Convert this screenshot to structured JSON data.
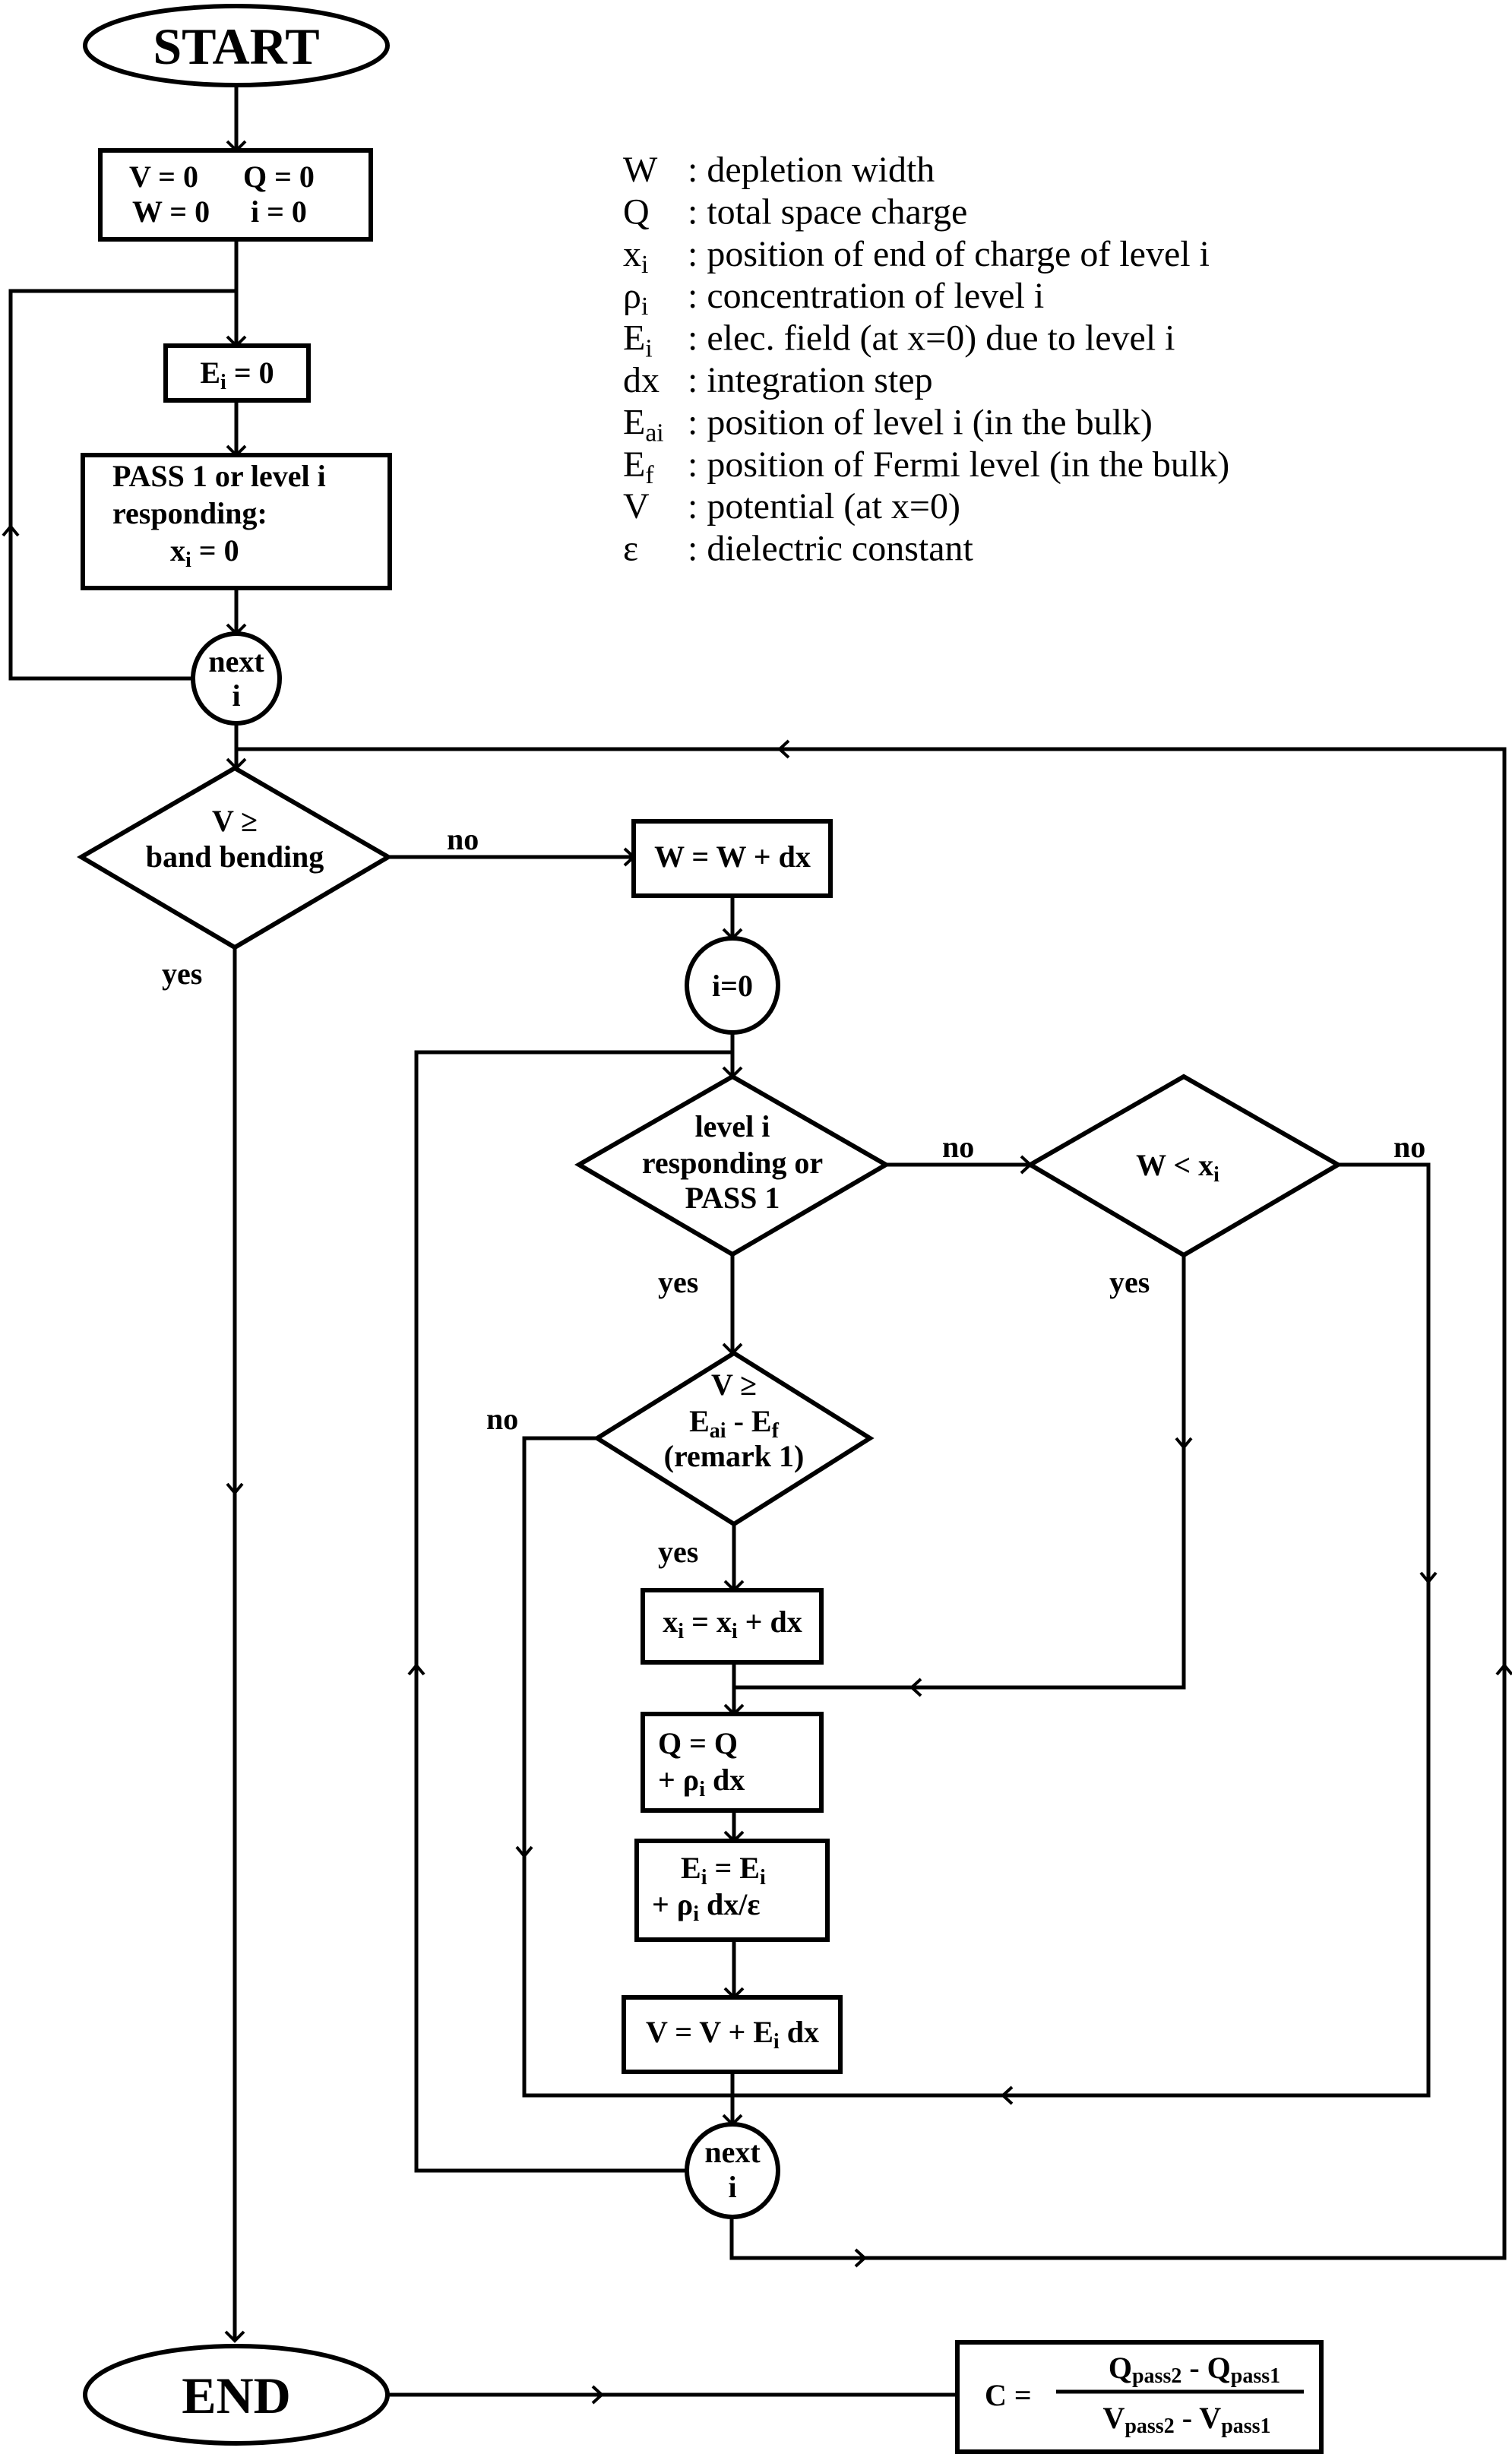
{
  "legend": [
    {
      "symbol": "W",
      "sub": "",
      "description": ": depletion width"
    },
    {
      "symbol": "Q",
      "sub": "",
      "description": ": total space charge"
    },
    {
      "symbol": "x",
      "sub": "i",
      "description": ": position of end of charge of level i"
    },
    {
      "symbol": "ρ",
      "sub": "i",
      "description": ": concentration of level i"
    },
    {
      "symbol": "E",
      "sub": "i",
      "description": ": elec. field (at x=0) due to level i"
    },
    {
      "symbol": "dx",
      "sub": "",
      "description": ": integration step"
    },
    {
      "symbol": "E",
      "sub": "ai",
      "description": ": position of level i (in the bulk)"
    },
    {
      "symbol": "E",
      "sub": "f",
      "description": ": position of Fermi level (in the bulk)"
    },
    {
      "symbol": "V",
      "sub": "",
      "description": ": potential (at x=0)"
    },
    {
      "symbol": "ε",
      "sub": "",
      "description": ": dielectric constant"
    }
  ],
  "nodes": {
    "start": "START",
    "init": {
      "line1a": "V = 0",
      "line1b": "Q = 0",
      "line2a": "W = 0",
      "line2b": "i = 0"
    },
    "ei_reset": {
      "pre": "E",
      "sub": "i",
      "post": " = 0"
    },
    "pass_box": {
      "line1": "PASS 1 or level i",
      "line2": "responding:",
      "line3_pre": "x",
      "line3_sub": "i",
      "line3_post": " = 0"
    },
    "next1": {
      "line1": "next",
      "line2": "i"
    },
    "decision_band": {
      "line1": "V ≥",
      "line2": "band bending"
    },
    "w_update": "W = W + dx",
    "i_zero": "i=0",
    "decision_level": {
      "line1": "level i",
      "line2": "responding or",
      "line3": "PASS 1"
    },
    "decision_w": {
      "pre": "W < x",
      "sub": "i"
    },
    "decision_v": {
      "line1": "V ≥",
      "line2_a": "E",
      "line2_a_sub": "ai",
      "line2_b": " - E",
      "line2_b_sub": "f",
      "line3": "(remark 1)"
    },
    "xi_update": {
      "a": "x",
      "a_sub": "i",
      "b": " = x",
      "b_sub": "i",
      "c": " + dx"
    },
    "q_update": {
      "line1": "Q = Q",
      "line2_pre": "+ ρ",
      "line2_sub": "i",
      "line2_post": " dx"
    },
    "e_update": {
      "line1_a": "E",
      "line1_a_sub": "i",
      "line1_b": " = E",
      "line1_b_sub": "i",
      "line2_pre": "+ ρ",
      "line2_sub": "i",
      "line2_post": " dx/ε"
    },
    "v_update": {
      "pre": "V = V + E",
      "sub": "i",
      "post": " dx"
    },
    "next2": {
      "line1": "next",
      "line2": "i"
    },
    "end": "END",
    "capacitance": {
      "lhs": "C =",
      "num_a": "Q",
      "num_a_sub": "pass2",
      "num_b": " - Q",
      "num_b_sub": "pass1",
      "den_a": "V",
      "den_a_sub": "pass2",
      "den_b": " - V",
      "den_b_sub": "pass1"
    }
  },
  "edge_labels": {
    "band_no": "no",
    "band_yes": "yes",
    "level_no": "no",
    "level_yes": "yes",
    "w_no": "no",
    "w_yes": "yes",
    "v_no": "no",
    "v_yes": "yes"
  }
}
